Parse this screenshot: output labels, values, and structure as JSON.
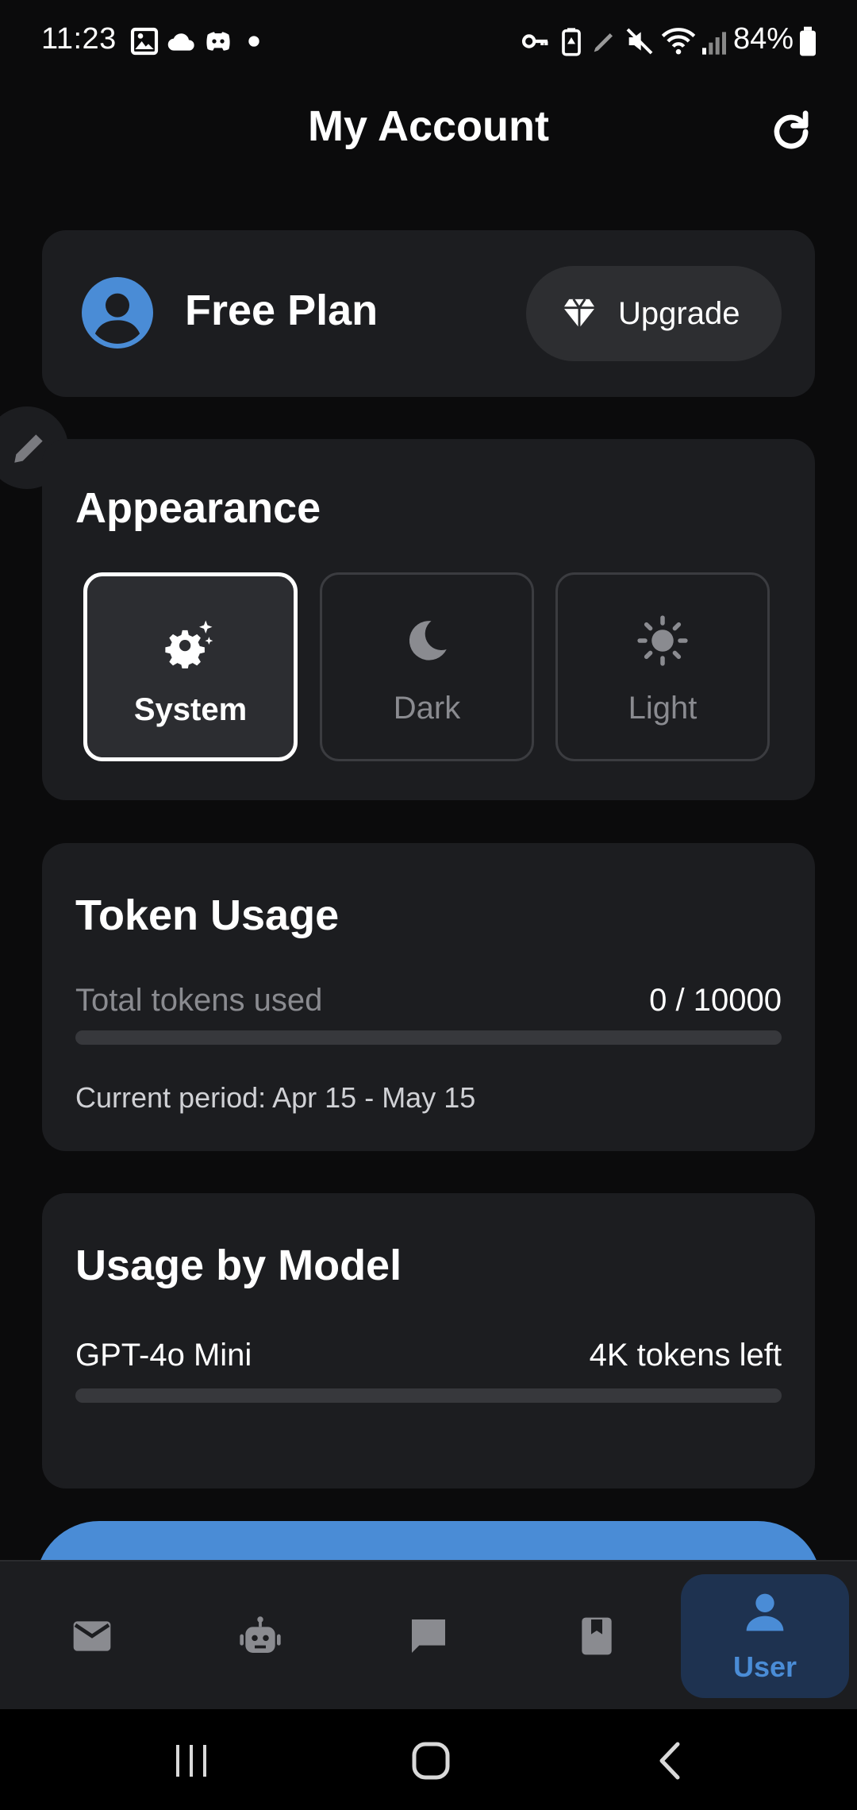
{
  "status_bar": {
    "time": "11:23",
    "battery": "84%"
  },
  "header": {
    "title": "My Account"
  },
  "plan": {
    "name": "Free Plan",
    "upgrade_label": "Upgrade"
  },
  "appearance": {
    "title": "Appearance",
    "options": [
      {
        "label": "System",
        "icon": "gear-sparkle-icon",
        "selected": true
      },
      {
        "label": "Dark",
        "icon": "moon-icon",
        "selected": false
      },
      {
        "label": "Light",
        "icon": "sun-icon",
        "selected": false
      }
    ]
  },
  "token_usage": {
    "title": "Token Usage",
    "label": "Total tokens used",
    "value": "0 / 10000",
    "progress": 0,
    "period": "Current period: Apr 15 - May 15"
  },
  "usage_by_model": {
    "title": "Usage by Model",
    "models": [
      {
        "name": "GPT-4o Mini",
        "value": "4K tokens left",
        "progress": 0
      }
    ]
  },
  "bottom_nav": {
    "items": [
      {
        "icon": "mail-icon"
      },
      {
        "icon": "robot-icon"
      },
      {
        "icon": "chat-icon"
      },
      {
        "icon": "bookmark-book-icon"
      },
      {
        "icon": "user-icon",
        "label": "User",
        "active": true
      }
    ]
  },
  "colors": {
    "accent": "#4a8cd6",
    "background": "#0b0b0c",
    "card": "#1c1d20"
  }
}
